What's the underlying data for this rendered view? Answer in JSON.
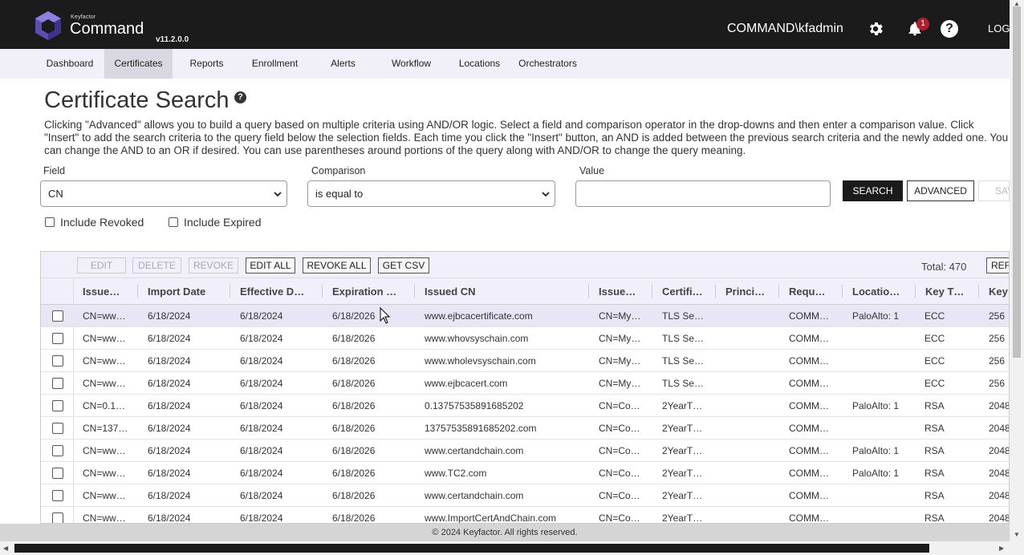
{
  "header": {
    "brand_small": "Keyfactor",
    "brand_name": "Command",
    "version": "v11.2.0.0",
    "user": "COMMAND\\kfadmin",
    "notification_count": "1",
    "help_glyph": "?",
    "logout_label": "LOG"
  },
  "nav": {
    "items": [
      "Dashboard",
      "Certificates",
      "Reports",
      "Enrollment",
      "Alerts",
      "Workflow",
      "Locations",
      "Orchestrators"
    ],
    "active": "Certificates"
  },
  "page": {
    "title": "Certificate Search",
    "help_glyph": "?",
    "description": "Clicking \"Advanced\" allows you to build a query based on multiple criteria using AND/OR logic. Select a field and comparison operator in the drop-downs and then enter a comparison value. Click \"Insert\" to add the search criteria to the query field below the selection fields. Each time you click the \"Insert\" button, an AND is added between the previous search criteria and the newly added one. You can change the AND to an OR if desired. You can use parentheses around portions of the query along with AND/OR to change the query meaning."
  },
  "search": {
    "field_label": "Field",
    "field_value": "CN",
    "comparison_label": "Comparison",
    "comparison_value": "is equal to",
    "value_label": "Value",
    "value": "",
    "search_button": "SEARCH",
    "advanced_button": "ADVANCED",
    "save_button": "SAVE",
    "include_revoked": "Include Revoked",
    "include_expired": "Include Expired"
  },
  "grid": {
    "toolbar": {
      "edit": "EDIT",
      "delete": "DELETE",
      "revoke": "REVOKE",
      "edit_all": "EDIT ALL",
      "revoke_all": "REVOKE ALL",
      "get_csv": "GET CSV",
      "total": "Total: 470",
      "refresh": "REFRESH"
    },
    "columns": [
      "Issue…",
      "Import Date",
      "Effective D…",
      "Expiration …",
      "Issued CN",
      "Issue…",
      "Certifi…",
      "Princi…",
      "Requ…",
      "Locatio…",
      "Key T…",
      "Key"
    ],
    "rows": [
      [
        "CN=ww…",
        "6/18/2024",
        "6/18/2024",
        "6/18/2026",
        "www.ejbcacertificate.com",
        "CN=My…",
        "TLS Se…",
        "",
        "COMM…",
        "PaloAlto: 1",
        "ECC",
        "256"
      ],
      [
        "CN=ww…",
        "6/18/2024",
        "6/18/2024",
        "6/18/2026",
        "www.whovsyschain.com",
        "CN=My…",
        "TLS Se…",
        "",
        "COMM…",
        "",
        "ECC",
        "256"
      ],
      [
        "CN=ww…",
        "6/18/2024",
        "6/18/2024",
        "6/18/2026",
        "www.wholevsyschain.com",
        "CN=My…",
        "TLS Se…",
        "",
        "COMM…",
        "",
        "ECC",
        "256"
      ],
      [
        "CN=ww…",
        "6/18/2024",
        "6/18/2024",
        "6/18/2026",
        "www.ejbcacert.com",
        "CN=My…",
        "TLS Se…",
        "",
        "COMM…",
        "",
        "ECC",
        "256"
      ],
      [
        "CN=0.1…",
        "6/18/2024",
        "6/18/2024",
        "6/18/2026",
        "0.13757535891685202",
        "CN=Co…",
        "2YearT…",
        "",
        "COMM…",
        "PaloAlto: 1",
        "RSA",
        "2048"
      ],
      [
        "CN=137…",
        "6/18/2024",
        "6/18/2024",
        "6/18/2026",
        "13757535891685202.com",
        "CN=Co…",
        "2YearT…",
        "",
        "COMM…",
        "",
        "RSA",
        "2048"
      ],
      [
        "CN=ww…",
        "6/18/2024",
        "6/18/2024",
        "6/18/2026",
        "www.certandchain.com",
        "CN=Co…",
        "2YearT…",
        "",
        "COMM…",
        "PaloAlto: 1",
        "RSA",
        "2048"
      ],
      [
        "CN=ww…",
        "6/18/2024",
        "6/18/2024",
        "6/18/2026",
        "www.TC2.com",
        "CN=Co…",
        "2YearT…",
        "",
        "COMM…",
        "PaloAlto: 1",
        "RSA",
        "2048"
      ],
      [
        "CN=ww…",
        "6/18/2024",
        "6/18/2024",
        "6/18/2026",
        "www.certandchain.com",
        "CN=Co…",
        "2YearT…",
        "",
        "COMM…",
        "",
        "RSA",
        "2048"
      ],
      [
        "CN=ww…",
        "6/18/2024",
        "6/18/2024",
        "6/18/2026",
        "www.ImportCertAndChain.com",
        "CN=Co…",
        "2YearT…",
        "",
        "COMM…",
        "",
        "RSA",
        "2048"
      ]
    ]
  },
  "footer": {
    "copyright": "© 2024 Keyfactor. All rights reserved."
  },
  "colors": {
    "topbar": "#1b1b1b",
    "nav_background": "#f1eff9",
    "badge": "#b01f2e",
    "logo": "#5a4fb0"
  }
}
